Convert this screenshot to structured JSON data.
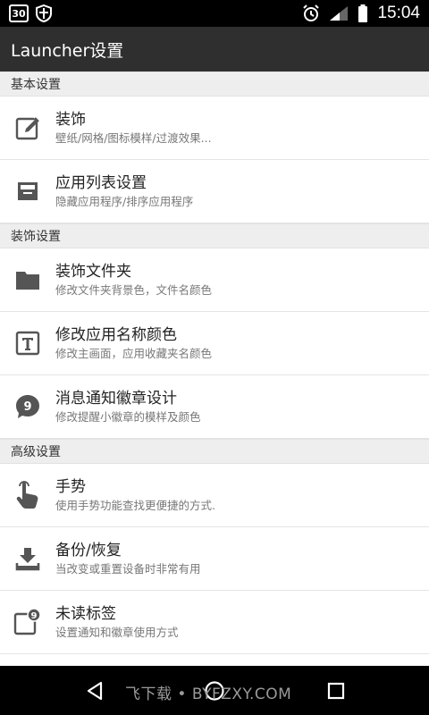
{
  "status_bar": {
    "calendar_day": "30",
    "time": "15:04",
    "icons": [
      "calendar-icon",
      "shield-icon",
      "alarm-icon",
      "signal-icon",
      "battery-icon"
    ]
  },
  "app_bar": {
    "title": "Launcher设置"
  },
  "sections": [
    {
      "header": "基本设置",
      "items": [
        {
          "icon": "edit-icon",
          "title": "装饰",
          "subtitle": "壁纸/网格/图标模样/过渡效果..."
        },
        {
          "icon": "tray-icon",
          "title": "应用列表设置",
          "subtitle": "隐藏应用程序/排序应用程序"
        }
      ]
    },
    {
      "header": "装饰设置",
      "items": [
        {
          "icon": "folder-icon",
          "title": "装饰文件夹",
          "subtitle": "修改文件夹背景色，文件名颜色"
        },
        {
          "icon": "text-icon",
          "title": "修改应用名称颜色",
          "subtitle": "修改主画面，应用收藏夹名颜色"
        },
        {
          "icon": "badge-bubble-icon",
          "title": "消息通知徽章设计",
          "subtitle": "修改提醒小徽章的模样及颜色",
          "badge": "9"
        }
      ]
    },
    {
      "header": "高级设置",
      "items": [
        {
          "icon": "gesture-hand-icon",
          "title": "手势",
          "subtitle": "使用手势功能查找更便捷的方式."
        },
        {
          "icon": "download-icon",
          "title": "备份/恢复",
          "subtitle": "当改变或重置设备时非常有用"
        },
        {
          "icon": "unread-badge-icon",
          "title": "未读标签",
          "subtitle": "设置通知和徽章使用方式",
          "badge": "9"
        }
      ]
    }
  ],
  "nav_bar": {
    "watermark": "飞下载 • BYFZXY.COM",
    "buttons": [
      "back-icon",
      "home-icon",
      "recents-icon"
    ]
  },
  "colors": {
    "status_bar": "#000000",
    "app_bar": "#2f2f2f",
    "section_header_bg": "#eeeeee",
    "icon_color": "#555555",
    "nav_bar": "#000000"
  }
}
